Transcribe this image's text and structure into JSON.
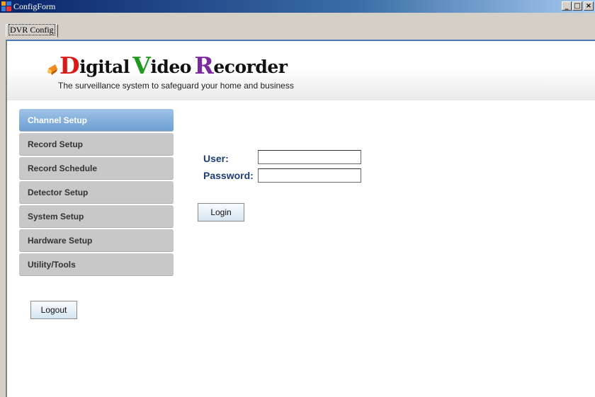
{
  "window": {
    "title": "ConfigForm",
    "icon": "app-window-icon",
    "minimize_glyph": "_",
    "maximize_glyph": "□",
    "close_glyph": "×"
  },
  "tabs": [
    {
      "label": "DVR Config",
      "selected": true
    }
  ],
  "header": {
    "logo": {
      "word1_initial": "D",
      "word1_rest": "igital",
      "word2_initial": "V",
      "word2_rest": "ideo",
      "word3_initial": "R",
      "word3_rest": "ecorder"
    },
    "tagline": "The surveillance system to safeguard your home and business"
  },
  "sidebar": {
    "items": [
      {
        "label": "Channel Setup",
        "active": true
      },
      {
        "label": "Record Setup",
        "active": false
      },
      {
        "label": "Record Schedule",
        "active": false
      },
      {
        "label": "Detector Setup",
        "active": false
      },
      {
        "label": "System Setup",
        "active": false
      },
      {
        "label": "Hardware Setup",
        "active": false
      },
      {
        "label": "Utility/Tools",
        "active": false
      }
    ],
    "logout_label": "Logout"
  },
  "login": {
    "user_label": "User:",
    "user_value": "",
    "password_label": "Password:",
    "password_value": "",
    "login_label": "Login"
  },
  "colors": {
    "active_nav": "#6b9ed2",
    "inactive_nav": "#c8c8c8",
    "label_blue": "#1e3c78",
    "logo_d": "#d81a1a",
    "logo_v": "#1f9a1f",
    "logo_r": "#7b2aa0"
  }
}
